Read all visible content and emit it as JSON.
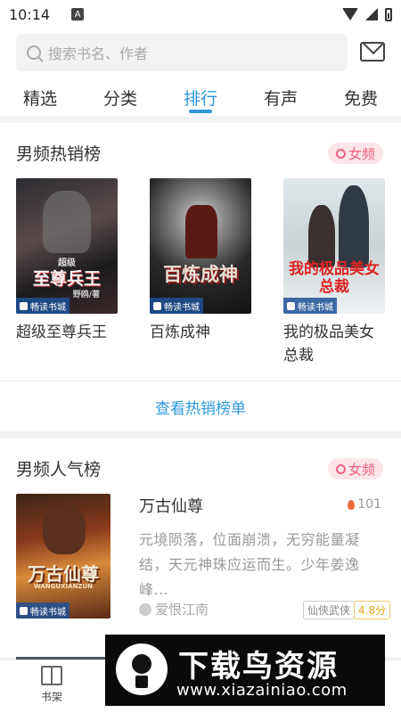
{
  "status_bar": {
    "time": "10:14",
    "indicator": "A"
  },
  "search": {
    "placeholder": "搜索书名、作者"
  },
  "tabs": [
    {
      "label": "精选"
    },
    {
      "label": "分类"
    },
    {
      "label": "排行"
    },
    {
      "label": "有声"
    },
    {
      "label": "免费"
    }
  ],
  "active_tab": "排行",
  "accent_color": "#2c97de",
  "hot_list": {
    "title": "男频热销榜",
    "channel_toggle": "女频",
    "more_label": "查看热销榜单",
    "books": [
      {
        "name": "超级至尊兵王",
        "cover_small": "超级",
        "cover_main": "至尊兵王",
        "cover_author": "野鸥/著",
        "brand": "畅读书城"
      },
      {
        "name": "百炼成神",
        "cover_main": "百炼成神",
        "brand": "畅读书城"
      },
      {
        "name": "我的极品美女总裁",
        "cover_main": "我的极品美女总裁",
        "brand": "畅读书城"
      }
    ]
  },
  "popular_list": {
    "title": "男频人气榜",
    "channel_toggle": "女频",
    "top_book": {
      "name": "万古仙尊",
      "hot": "101",
      "description": "元境陨落，位面崩溃，无穷能量凝结，天元神珠应运而生。少年姜逸峰...",
      "author": "爱恨江南",
      "genre": "仙侠武侠",
      "score": "4.8分",
      "cover_main": "万古仙尊",
      "cover_sub": "WANGUXIANZUN",
      "brand": "畅读书城"
    }
  },
  "bottom_nav": {
    "shelf_label": "书架"
  },
  "watermark": {
    "title": "下载鸟资源",
    "url": "www.xiazainiao.com"
  }
}
